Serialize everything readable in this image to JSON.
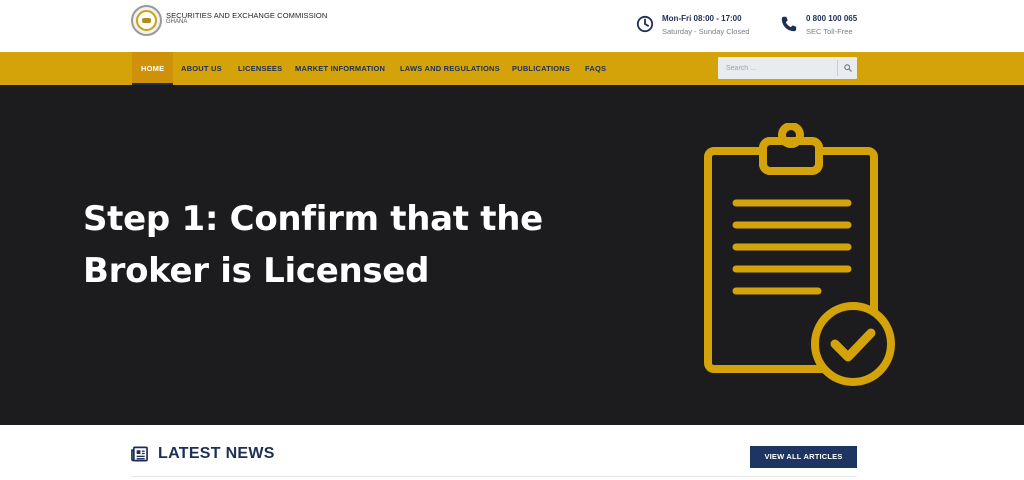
{
  "header": {
    "logo_icon": "sec-seal-logo",
    "brand_name": "SECURITIES AND EXCHANGE COMMISSION",
    "brand_sub": "GHANA",
    "hours": {
      "icon": "clock-icon",
      "line1": "Mon-Fri 08:00 - 17:00",
      "line2": "Saturday - Sunday Closed"
    },
    "phone": {
      "icon": "phone-icon",
      "line1": "0 800 100 065",
      "line2": "SEC Toll-Free"
    }
  },
  "nav": {
    "items": [
      {
        "label": "HOME",
        "active": true
      },
      {
        "label": "ABOUT US"
      },
      {
        "label": "LICENSEES"
      },
      {
        "label": "MARKET INFORMATION"
      },
      {
        "label": "LAWS AND REGULATIONS"
      },
      {
        "label": "PUBLICATIONS"
      },
      {
        "label": "FAQS"
      }
    ],
    "search": {
      "placeholder": "Search ...",
      "icon": "search-icon"
    }
  },
  "hero": {
    "title": "Step 1: Confirm that the Broker is Licensed",
    "illustration": "clipboard-check-icon"
  },
  "news": {
    "icon": "newspaper-icon",
    "title": "LATEST NEWS",
    "view_all_label": "VIEW ALL ARTICLES"
  },
  "colors": {
    "navbar": "#d4a30a",
    "navy": "#1d2f55",
    "hero_bg": "#1c1c1e",
    "gold_icon": "#d4a30a"
  }
}
